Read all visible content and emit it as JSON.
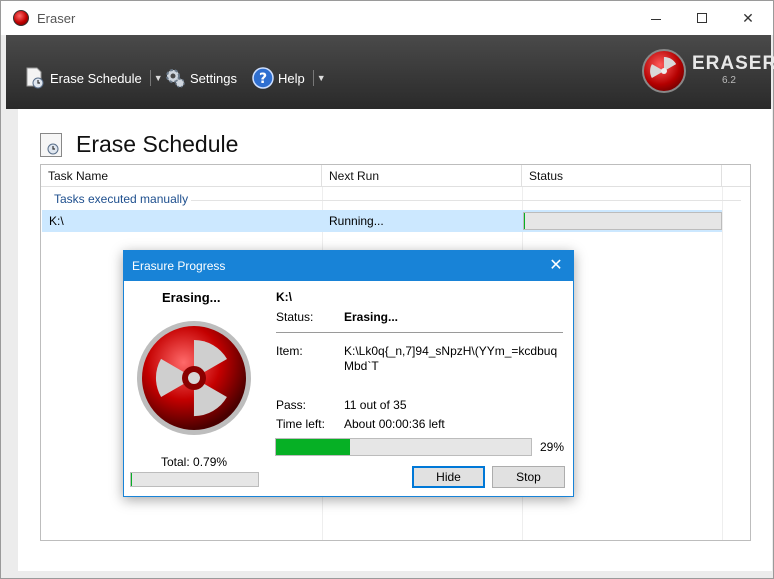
{
  "window": {
    "title": "Eraser"
  },
  "toolbar": {
    "erase_schedule": "Erase Schedule",
    "settings": "Settings",
    "help": "Help"
  },
  "brand": {
    "name": "ERASER",
    "version": "6.2"
  },
  "page": {
    "title": "Erase Schedule"
  },
  "table": {
    "columns": [
      "Task Name",
      "Next Run",
      "Status"
    ],
    "group": "Tasks executed manually",
    "rows": [
      {
        "name": "K:\\",
        "next_run": "Running...",
        "status_progress": 0.0
      }
    ]
  },
  "dialog": {
    "title": "Erasure Progress",
    "erasing_title": "Erasing...",
    "total_label": "Total: 0.79%",
    "total_progress": 0.79,
    "target": "K:\\",
    "status_label": "Status:",
    "status_value": "Erasing...",
    "item_label": "Item:",
    "item_value": "K:\\Lk0q{_n,7]94_sNpzH\\(YYm_=kcdbuqMbd`T",
    "pass_label": "Pass:",
    "pass_value": "11 out of 35",
    "time_label": "Time left:",
    "time_value": "About 00:00:36 left",
    "task_percent": "29%",
    "task_progress": 29,
    "hide_label": "Hide",
    "stop_label": "Stop"
  },
  "colors": {
    "accent": "#1883d7",
    "progress": "#06b025",
    "toolbar": "#333333",
    "selection": "#cce8ff"
  }
}
